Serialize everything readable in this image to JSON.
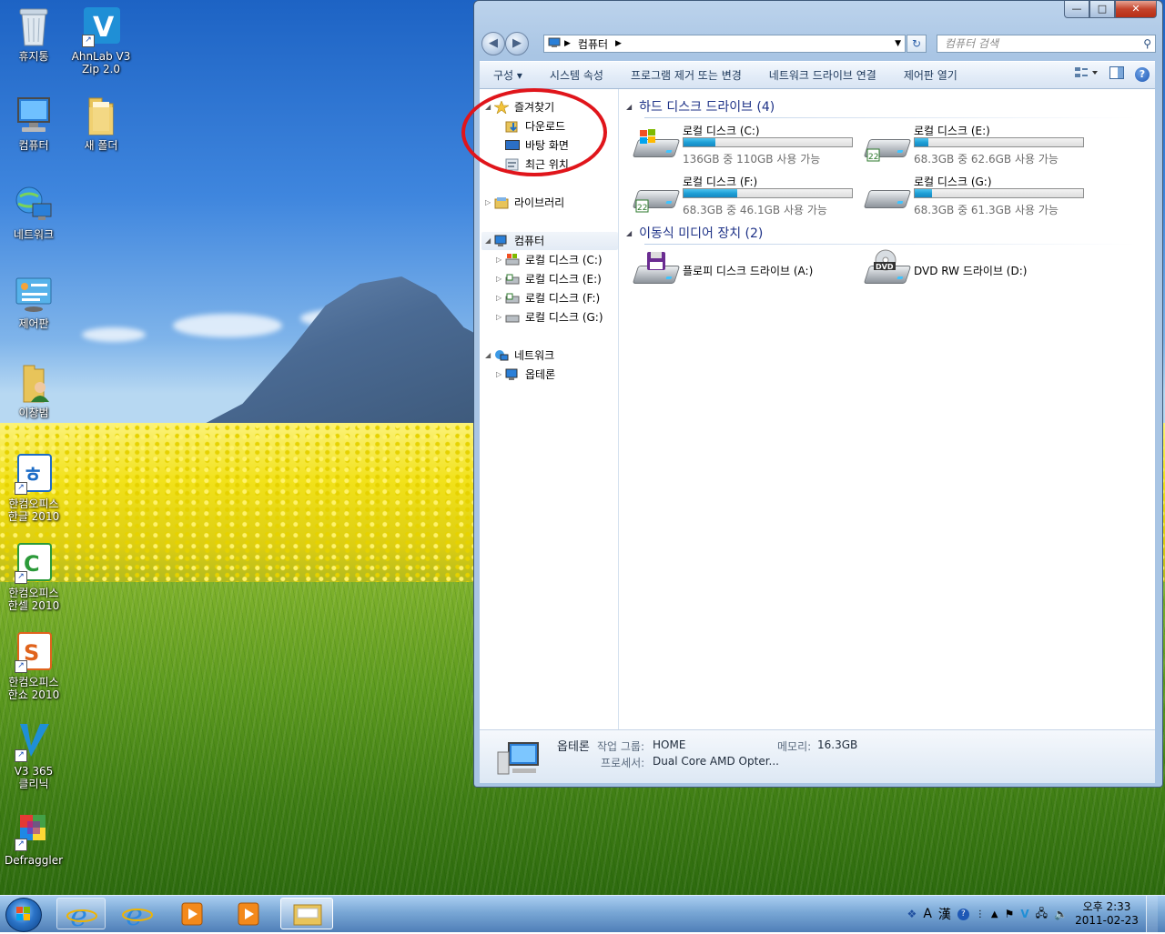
{
  "desktop": {
    "icons": [
      {
        "label": "휴지통"
      },
      {
        "label": "AhnLab V3\nZip 2.0"
      },
      {
        "label": "컴퓨터"
      },
      {
        "label": "새 폴더"
      },
      {
        "label": "네트워크"
      },
      {
        "label": "제어판"
      },
      {
        "label": "이창범"
      },
      {
        "label": "한컴오피스\n한글 2010"
      },
      {
        "label": "한컴오피스\n한셀 2010"
      },
      {
        "label": "한컴오피스\n한쇼 2010"
      },
      {
        "label": "V3 365\n클리닉"
      },
      {
        "label": "Defraggler"
      }
    ]
  },
  "explorer": {
    "window_controls": {
      "minimize": "—",
      "maximize": "□",
      "close": "✕"
    },
    "address": {
      "root_icon": "computer-icon",
      "crumb": "컴퓨터"
    },
    "search": {
      "placeholder": "컴퓨터 검색"
    },
    "toolbar": {
      "organize": "구성 ▾",
      "system_properties": "시스템 속성",
      "uninstall": "프로그램 제거 또는 변경",
      "map_drive": "네트워크 드라이브 연결",
      "control_panel": "제어판 열기"
    },
    "nav": {
      "favorites": "즐겨찾기",
      "downloads": "다운로드",
      "desktop": "바탕 화면",
      "recent": "최근 위치",
      "libraries": "라이브러리",
      "computer": "컴퓨터",
      "drive_c": "로컬 디스크 (C:)",
      "drive_e": "로컬 디스크 (E:)",
      "drive_f": "로컬 디스크 (F:)",
      "drive_g": "로컬 디스크 (G:)",
      "network": "네트워크",
      "network_pc": "옵테론"
    },
    "groups": {
      "hdd": "하드 디스크 드라이브 (4)",
      "removable": "이동식 미디어 장치 (2)"
    },
    "drives": [
      {
        "name": "로컬 디스크 (C:)",
        "free": "136GB 중 110GB 사용 가능",
        "used_percent": 19
      },
      {
        "name": "로컬 디스크 (E:)",
        "free": "68.3GB 중 62.6GB 사용 가능",
        "used_percent": 8
      },
      {
        "name": "로컬 디스크 (F:)",
        "free": "68.3GB 중 46.1GB 사용 가능",
        "used_percent": 32
      },
      {
        "name": "로컬 디스크 (G:)",
        "free": "68.3GB 중 61.3GB 사용 가능",
        "used_percent": 10
      }
    ],
    "removable": [
      {
        "name": "플로피 디스크 드라이브 (A:)"
      },
      {
        "name": "DVD RW 드라이브 (D:)"
      }
    ],
    "details": {
      "pc_name": "옵테론",
      "workgroup_label": "작업 그룹:",
      "workgroup": "HOME",
      "memory_label": "메모리:",
      "memory": "16.3GB",
      "processor_label": "프로세서:",
      "processor": "Dual Core AMD Opter..."
    }
  },
  "taskbar": {
    "tray": {
      "lang_a": "A",
      "lang_han": "漢"
    },
    "clock_time": "오후 2:33",
    "clock_date": "2011-02-23"
  },
  "colors": {
    "annotation_circle": "#e0151b",
    "link_blue": "#1e3287",
    "usage_bar": "#1fa0d6"
  }
}
